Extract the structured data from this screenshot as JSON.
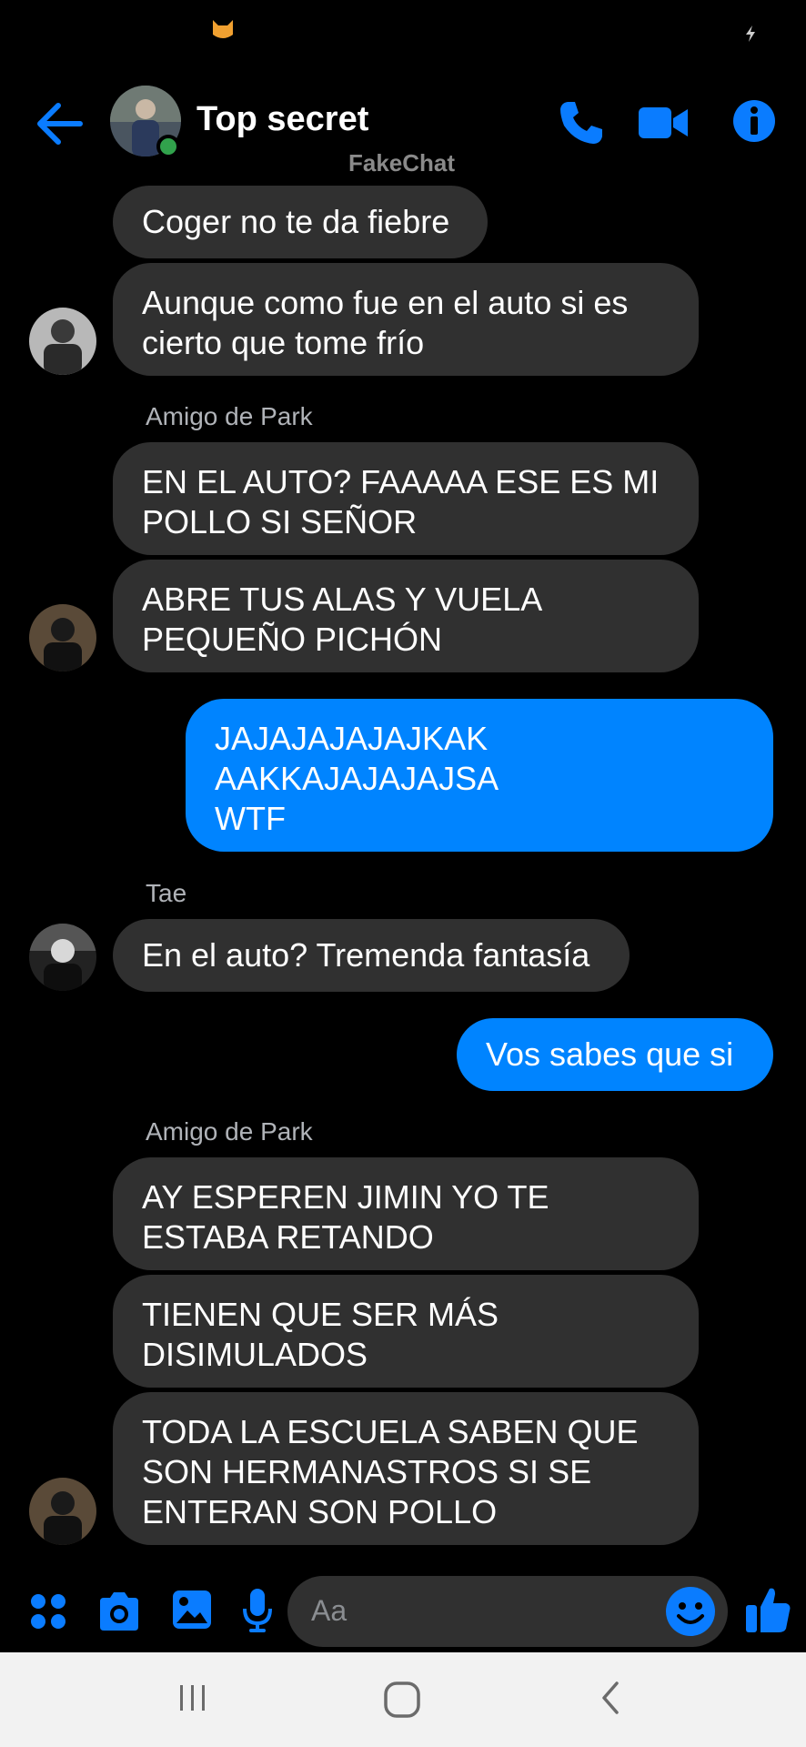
{
  "header": {
    "title": "Top secret",
    "watermark": "FakeChat"
  },
  "messages": {
    "m1": "Coger no te da fiebre",
    "m2_line1": "Aunque como fue en el auto si es",
    "m2_line2": "cierto que tome frío",
    "sender1": "Amigo de Park",
    "m3_line1": "EN EL AUTO? FAAAAA ESE ES MI",
    "m3_line2": "POLLO SI SEÑOR",
    "m4_line1": "ABRE TUS ALAS Y VUELA",
    "m4_line2": "PEQUEÑO PICHÓN",
    "m5_line1": "JAJAJAJAJAJKAK",
    "m5_line2": "AAKKAJAJAJAJSA",
    "m5_line3": "WTF",
    "sender2": "Tae",
    "m6": "En el auto? Tremenda fantasía",
    "m7": "Vos sabes que si",
    "sender3": "Amigo de Park",
    "m8_line1": "AY ESPEREN JIMIN YO TE",
    "m8_line2": "ESTABA RETANDO",
    "m9_line1": "TIENEN QUE SER MÁS",
    "m9_line2": "DISIMULADOS",
    "m10_line1": "TODA LA ESCUELA SABEN QUE",
    "m10_line2": "SON HERMANASTROS SI SE",
    "m10_line3": "ENTERAN SON POLLO"
  },
  "composer": {
    "placeholder": "Aa",
    "icons": [
      "apps-icon",
      "camera-icon",
      "gallery-icon",
      "microphone-icon",
      "emoji-icon",
      "thumbs-up-icon"
    ]
  },
  "navbar": {
    "icons": [
      "recent-apps-icon",
      "home-icon",
      "back-icon"
    ]
  },
  "colors": {
    "accent": "#0084ff",
    "incoming_bubble": "#303030",
    "background": "#000000",
    "online": "#31a24c"
  }
}
